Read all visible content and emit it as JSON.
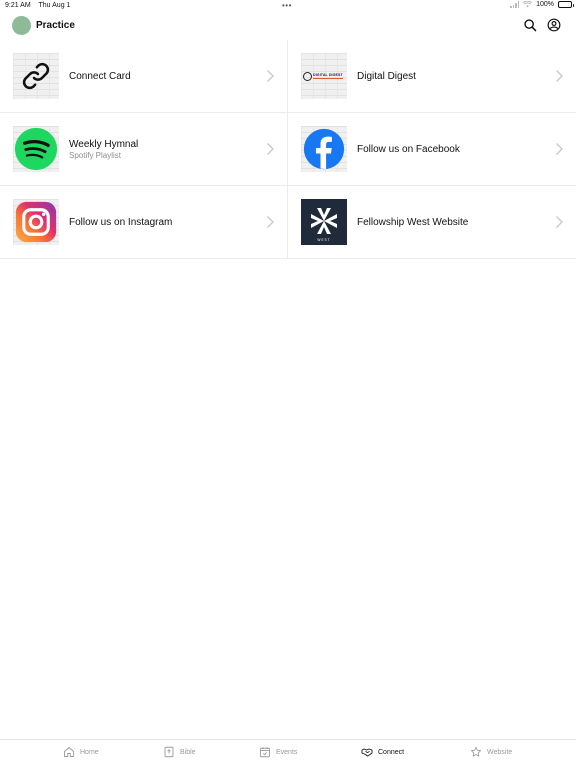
{
  "status": {
    "time": "9:21 AM",
    "date": "Thu Aug 1",
    "multitask": "•••",
    "battery_pct": "100%"
  },
  "header": {
    "title": "Practice",
    "avatar_color": "#8fba97"
  },
  "tiles": [
    {
      "title": "Connect Card",
      "subtitle": "",
      "icon": "link-icon"
    },
    {
      "title": "Digital Digest",
      "subtitle": "",
      "icon": "digital-digest-logo"
    },
    {
      "title": "Weekly Hymnal",
      "subtitle": "Spotify Playlist",
      "icon": "spotify-icon"
    },
    {
      "title": "Follow us on Facebook",
      "subtitle": "",
      "icon": "facebook-icon"
    },
    {
      "title": "Follow us on Instagram",
      "subtitle": "",
      "icon": "instagram-icon"
    },
    {
      "title": "Fellowship West Website",
      "subtitle": "",
      "icon": "fellowship-west-logo"
    }
  ],
  "logos": {
    "digest_text": "DIGITAL DIGEST",
    "west_text": "WEST"
  },
  "tabbar": {
    "items": [
      {
        "label": "Home",
        "icon": "home-icon",
        "active": false
      },
      {
        "label": "Bible",
        "icon": "bible-icon",
        "active": false
      },
      {
        "label": "Events",
        "icon": "calendar-icon",
        "active": false
      },
      {
        "label": "Connect",
        "icon": "handshake-icon",
        "active": true
      },
      {
        "label": "Website",
        "icon": "star-icon",
        "active": false
      }
    ]
  },
  "colors": {
    "spotify": "#1ed760",
    "facebook": "#1877f2",
    "instagram_start": "#fcaf45",
    "instagram_end": "#833ab4",
    "fellowship_navy": "#1f2b3a"
  }
}
